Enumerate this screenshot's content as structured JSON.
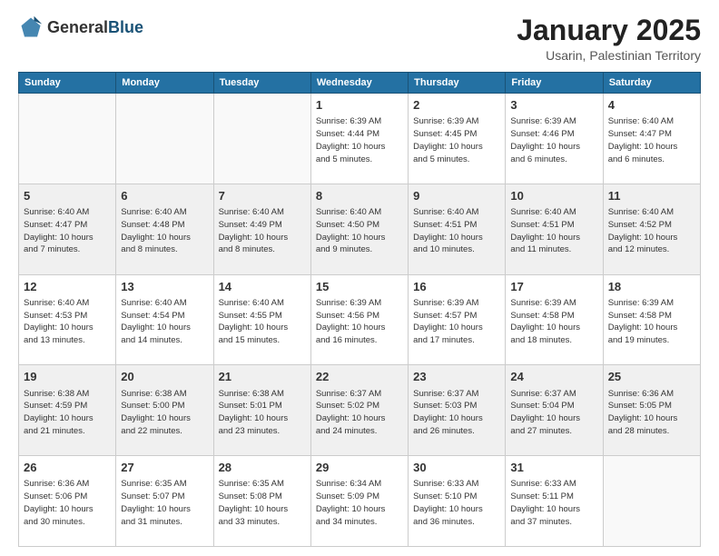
{
  "logo": {
    "general": "General",
    "blue": "Blue"
  },
  "header": {
    "title": "January 2025",
    "subtitle": "Usarin, Palestinian Territory"
  },
  "weekdays": [
    "Sunday",
    "Monday",
    "Tuesday",
    "Wednesday",
    "Thursday",
    "Friday",
    "Saturday"
  ],
  "weeks": [
    [
      {
        "day": "",
        "info": ""
      },
      {
        "day": "",
        "info": ""
      },
      {
        "day": "",
        "info": ""
      },
      {
        "day": "1",
        "info": "Sunrise: 6:39 AM\nSunset: 4:44 PM\nDaylight: 10 hours\nand 5 minutes."
      },
      {
        "day": "2",
        "info": "Sunrise: 6:39 AM\nSunset: 4:45 PM\nDaylight: 10 hours\nand 5 minutes."
      },
      {
        "day": "3",
        "info": "Sunrise: 6:39 AM\nSunset: 4:46 PM\nDaylight: 10 hours\nand 6 minutes."
      },
      {
        "day": "4",
        "info": "Sunrise: 6:40 AM\nSunset: 4:47 PM\nDaylight: 10 hours\nand 6 minutes."
      }
    ],
    [
      {
        "day": "5",
        "info": "Sunrise: 6:40 AM\nSunset: 4:47 PM\nDaylight: 10 hours\nand 7 minutes."
      },
      {
        "day": "6",
        "info": "Sunrise: 6:40 AM\nSunset: 4:48 PM\nDaylight: 10 hours\nand 8 minutes."
      },
      {
        "day": "7",
        "info": "Sunrise: 6:40 AM\nSunset: 4:49 PM\nDaylight: 10 hours\nand 8 minutes."
      },
      {
        "day": "8",
        "info": "Sunrise: 6:40 AM\nSunset: 4:50 PM\nDaylight: 10 hours\nand 9 minutes."
      },
      {
        "day": "9",
        "info": "Sunrise: 6:40 AM\nSunset: 4:51 PM\nDaylight: 10 hours\nand 10 minutes."
      },
      {
        "day": "10",
        "info": "Sunrise: 6:40 AM\nSunset: 4:51 PM\nDaylight: 10 hours\nand 11 minutes."
      },
      {
        "day": "11",
        "info": "Sunrise: 6:40 AM\nSunset: 4:52 PM\nDaylight: 10 hours\nand 12 minutes."
      }
    ],
    [
      {
        "day": "12",
        "info": "Sunrise: 6:40 AM\nSunset: 4:53 PM\nDaylight: 10 hours\nand 13 minutes."
      },
      {
        "day": "13",
        "info": "Sunrise: 6:40 AM\nSunset: 4:54 PM\nDaylight: 10 hours\nand 14 minutes."
      },
      {
        "day": "14",
        "info": "Sunrise: 6:40 AM\nSunset: 4:55 PM\nDaylight: 10 hours\nand 15 minutes."
      },
      {
        "day": "15",
        "info": "Sunrise: 6:39 AM\nSunset: 4:56 PM\nDaylight: 10 hours\nand 16 minutes."
      },
      {
        "day": "16",
        "info": "Sunrise: 6:39 AM\nSunset: 4:57 PM\nDaylight: 10 hours\nand 17 minutes."
      },
      {
        "day": "17",
        "info": "Sunrise: 6:39 AM\nSunset: 4:58 PM\nDaylight: 10 hours\nand 18 minutes."
      },
      {
        "day": "18",
        "info": "Sunrise: 6:39 AM\nSunset: 4:58 PM\nDaylight: 10 hours\nand 19 minutes."
      }
    ],
    [
      {
        "day": "19",
        "info": "Sunrise: 6:38 AM\nSunset: 4:59 PM\nDaylight: 10 hours\nand 21 minutes."
      },
      {
        "day": "20",
        "info": "Sunrise: 6:38 AM\nSunset: 5:00 PM\nDaylight: 10 hours\nand 22 minutes."
      },
      {
        "day": "21",
        "info": "Sunrise: 6:38 AM\nSunset: 5:01 PM\nDaylight: 10 hours\nand 23 minutes."
      },
      {
        "day": "22",
        "info": "Sunrise: 6:37 AM\nSunset: 5:02 PM\nDaylight: 10 hours\nand 24 minutes."
      },
      {
        "day": "23",
        "info": "Sunrise: 6:37 AM\nSunset: 5:03 PM\nDaylight: 10 hours\nand 26 minutes."
      },
      {
        "day": "24",
        "info": "Sunrise: 6:37 AM\nSunset: 5:04 PM\nDaylight: 10 hours\nand 27 minutes."
      },
      {
        "day": "25",
        "info": "Sunrise: 6:36 AM\nSunset: 5:05 PM\nDaylight: 10 hours\nand 28 minutes."
      }
    ],
    [
      {
        "day": "26",
        "info": "Sunrise: 6:36 AM\nSunset: 5:06 PM\nDaylight: 10 hours\nand 30 minutes."
      },
      {
        "day": "27",
        "info": "Sunrise: 6:35 AM\nSunset: 5:07 PM\nDaylight: 10 hours\nand 31 minutes."
      },
      {
        "day": "28",
        "info": "Sunrise: 6:35 AM\nSunset: 5:08 PM\nDaylight: 10 hours\nand 33 minutes."
      },
      {
        "day": "29",
        "info": "Sunrise: 6:34 AM\nSunset: 5:09 PM\nDaylight: 10 hours\nand 34 minutes."
      },
      {
        "day": "30",
        "info": "Sunrise: 6:33 AM\nSunset: 5:10 PM\nDaylight: 10 hours\nand 36 minutes."
      },
      {
        "day": "31",
        "info": "Sunrise: 6:33 AM\nSunset: 5:11 PM\nDaylight: 10 hours\nand 37 minutes."
      },
      {
        "day": "",
        "info": ""
      }
    ]
  ]
}
